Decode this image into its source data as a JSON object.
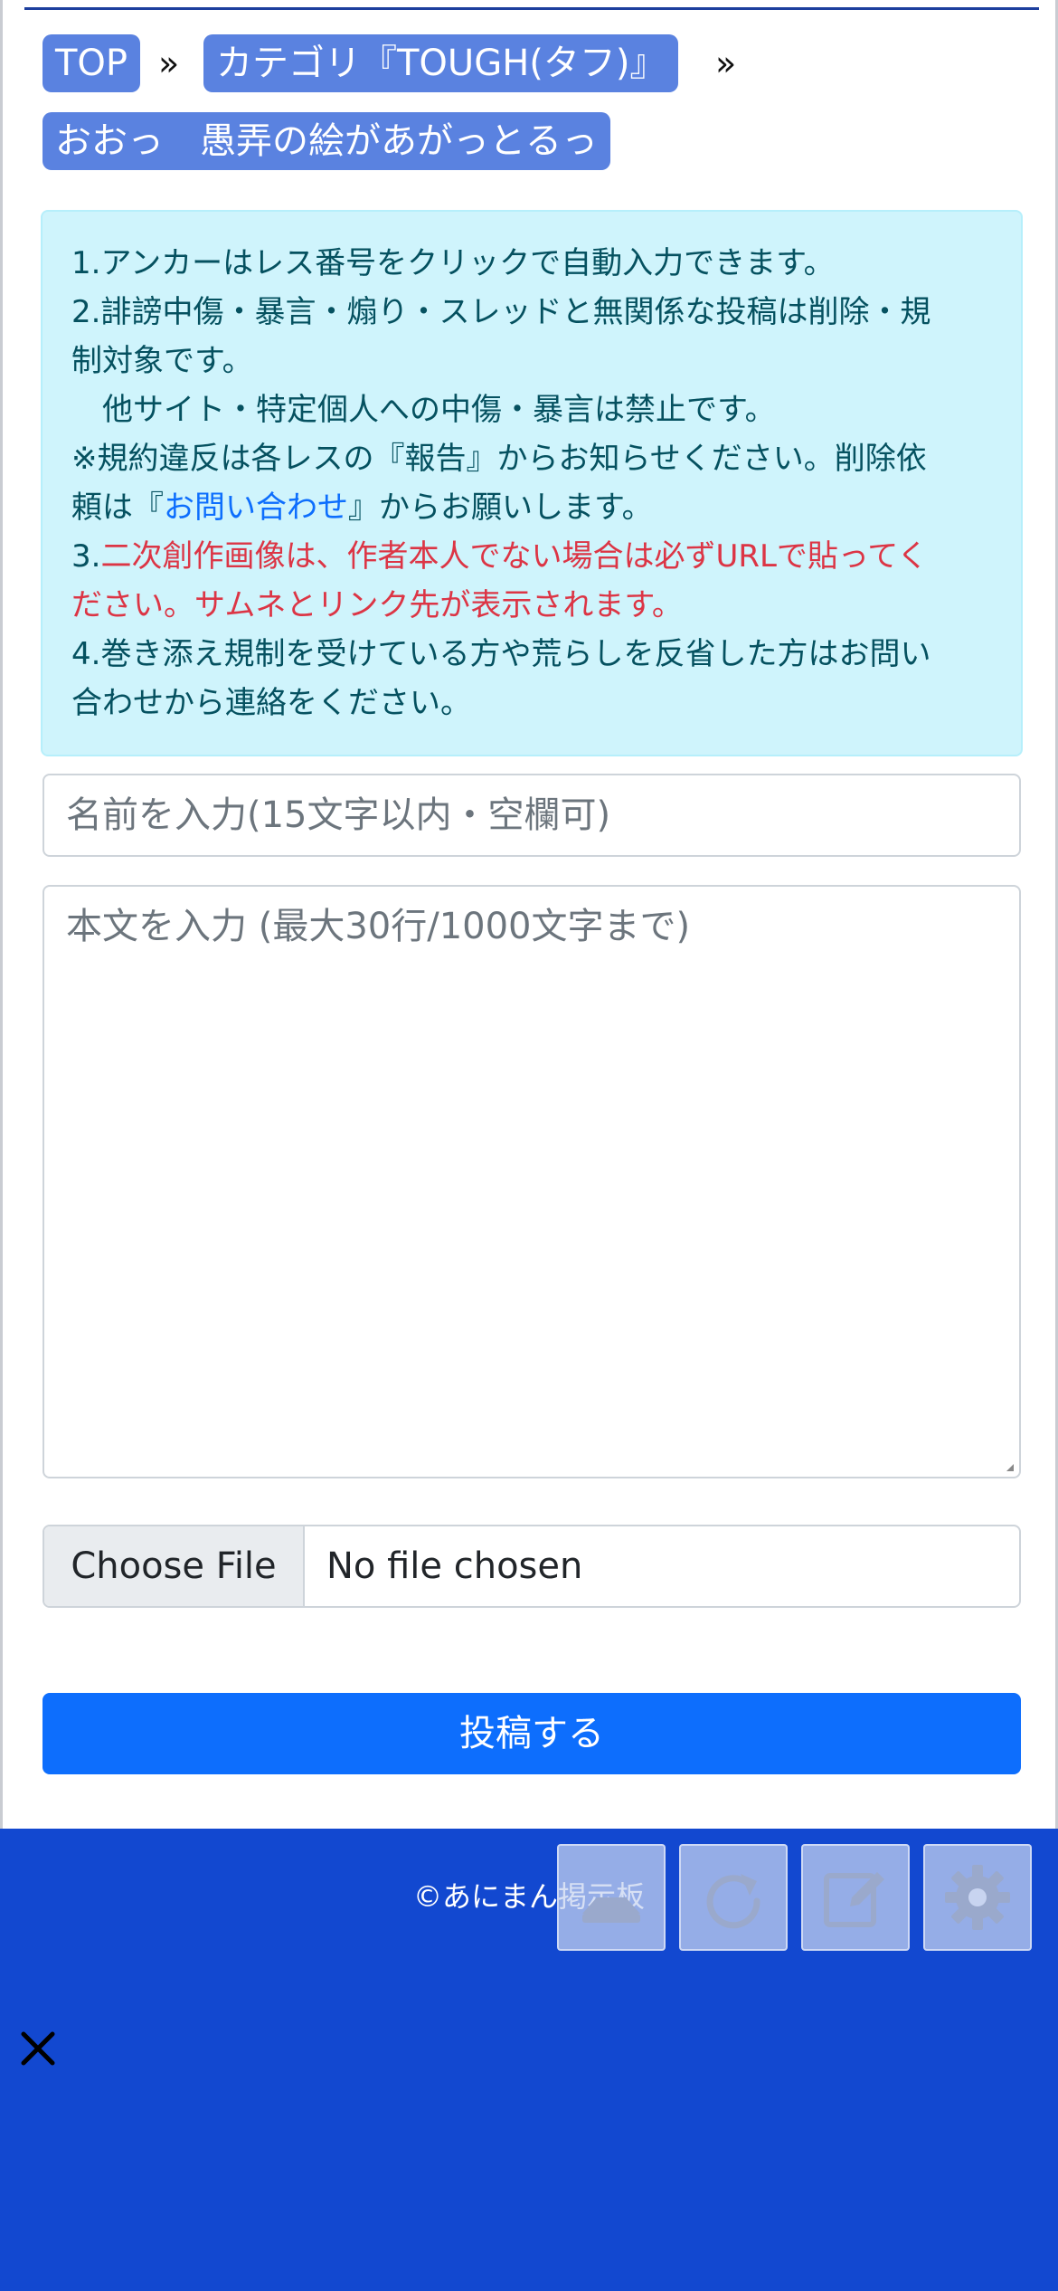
{
  "breadcrumb": {
    "top_label": "TOP",
    "category_label": "カテゴリ『TOUGH(タフ)』",
    "thread_label": "おおっ　愚弄の絵があがっとるっ",
    "separator": "»"
  },
  "notice": {
    "line1": "1.アンカーはレス番号をクリックで自動入力できます。",
    "line2": "2.誹謗中傷・暴言・煽り・スレッドと無関係な投稿は削除・規",
    "line3": "制対象です。",
    "line4": "　他サイト・特定個人への中傷・暴言は禁止です。",
    "line5": "※規約違反は各レスの『報告』からお知らせください。削除依",
    "line6_pre": "頼は『",
    "line6_link": "お問い合わせ",
    "line6_post": "』からお願いします。",
    "line7_num": "3.",
    "line7": "二次創作画像は、作者本人でない場合は必ずURLで貼ってく",
    "line8": "ださい。サムネとリンク先が表示されます。",
    "line9": "4.巻き添え規制を受けている方や荒らしを反省した方はお問い",
    "line10": "合わせから連絡をください。"
  },
  "form": {
    "name_placeholder": "名前を入力(15文字以内・空欄可)",
    "body_placeholder": "本文を入力 (最大30行/1000文字まで)",
    "file_button_label": "Choose File",
    "file_status": "No file chosen",
    "submit_label": "投稿する"
  },
  "footer": {
    "copyright": "©あにまん掲示板",
    "buttons": [
      "upload-icon",
      "refresh-icon",
      "edit-icon",
      "gear-icon"
    ]
  },
  "colors": {
    "accent": "#0d6efd",
    "crumb": "#5a82e0",
    "footer_bg": "#1248d0",
    "alert_bg": "#cff4fc",
    "danger": "#dc3545"
  }
}
